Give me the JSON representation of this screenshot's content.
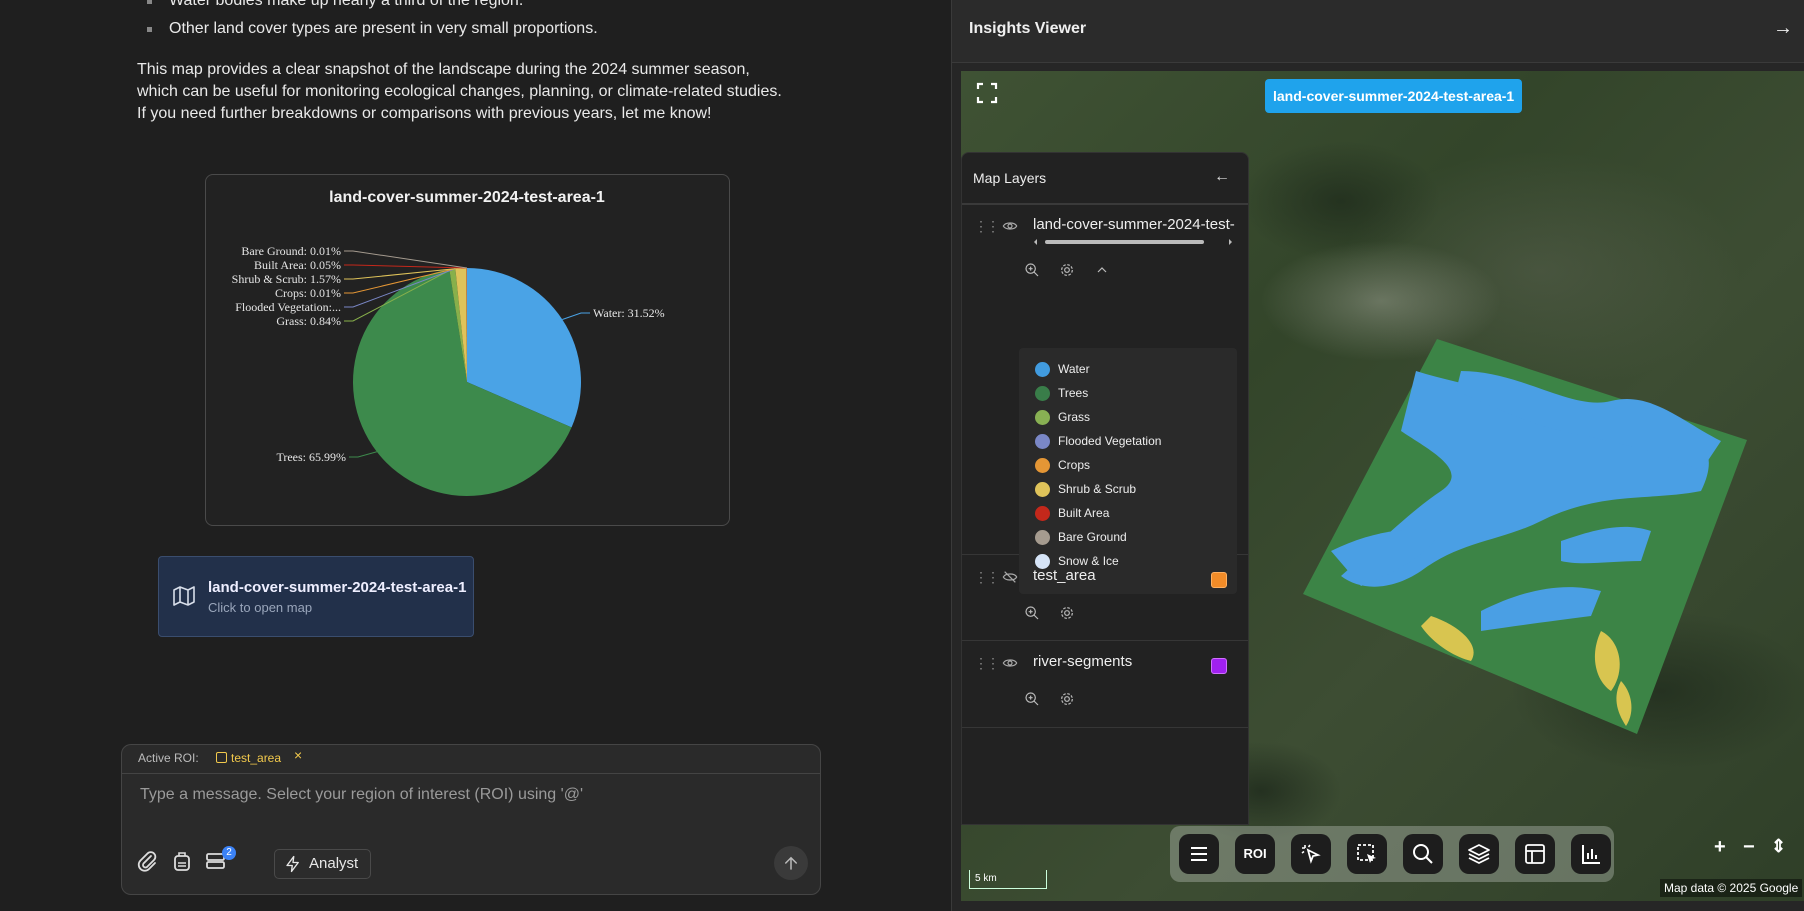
{
  "chat": {
    "bullet_1": "Water bodies make up nearly a third of the region.",
    "bullet_2": "Other land cover types are present in very small proportions.",
    "paragraph": "This map provides a clear snapshot of the landscape during the 2024 summer season, which can be useful for monitoring ecological changes, planning, or climate-related studies. If you need further breakdowns or comparisons with previous years, let me know!",
    "map_card": {
      "title": "land-cover-summer-2024-test-area-1",
      "subtitle": "Click to open map"
    }
  },
  "chart_data": {
    "type": "pie",
    "title": "land-cover-summer-2024-test-area-1",
    "slices": [
      {
        "label": "Water",
        "value": 31.52,
        "text": "Water: 31.52%",
        "color": "#4aa3e6"
      },
      {
        "label": "Trees",
        "value": 65.99,
        "text": "Trees: 65.99%",
        "color": "#3d8a4c"
      },
      {
        "label": "Grass",
        "value": 0.84,
        "text": "Grass: 0.84%",
        "color": "#88b04b"
      },
      {
        "label": "Flooded Vegetation",
        "value": 0.0,
        "text": "Flooded Vegetation:...",
        "color": "#7a87c6"
      },
      {
        "label": "Crops",
        "value": 0.01,
        "text": "Crops: 0.01%",
        "color": "#e49635"
      },
      {
        "label": "Shrub & Scrub",
        "value": 1.57,
        "text": "Shrub & Scrub: 1.57%",
        "color": "#dfc35a"
      },
      {
        "label": "Built Area",
        "value": 0.05,
        "text": "Built Area: 0.05%",
        "color": "#c4281b"
      },
      {
        "label": "Bare Ground",
        "value": 0.01,
        "text": "Bare Ground: 0.01%",
        "color": "#a59b8f"
      }
    ]
  },
  "composer": {
    "active_roi_label": "Active ROI:",
    "roi_name": "test_area",
    "roi_remove": "×",
    "placeholder": "Type a message. Select your region of interest (ROI) using '@'",
    "badge_count": "2",
    "analyst_label": "Analyst",
    "accent": "#f2c94c"
  },
  "viewer": {
    "title": "Insights Viewer",
    "map_chip": "land-cover-summer-2024-test-area-1",
    "layers_title": "Map Layers",
    "layers": [
      {
        "name": "land-cover-summer-2024-test-area-1",
        "visible": true
      },
      {
        "name": "test_area",
        "visible": false,
        "color": "#f28c28"
      },
      {
        "name": "river-segments",
        "visible": true,
        "color": "#a020f0"
      }
    ],
    "legend": [
      {
        "label": "Water",
        "color": "#419bdf"
      },
      {
        "label": "Trees",
        "color": "#397d49"
      },
      {
        "label": "Grass",
        "color": "#88b053"
      },
      {
        "label": "Flooded Vegetation",
        "color": "#7a87c6"
      },
      {
        "label": "Crops",
        "color": "#e49635"
      },
      {
        "label": "Shrub & Scrub",
        "color": "#dfc35a"
      },
      {
        "label": "Built Area",
        "color": "#c4281b"
      },
      {
        "label": "Bare Ground",
        "color": "#a59b8f"
      },
      {
        "label": "Snow & Ice",
        "color": "#b39fe1"
      }
    ],
    "toolbar_roi": "ROI",
    "scale": "5 km",
    "attribution": "Map data © 2025 Google"
  }
}
